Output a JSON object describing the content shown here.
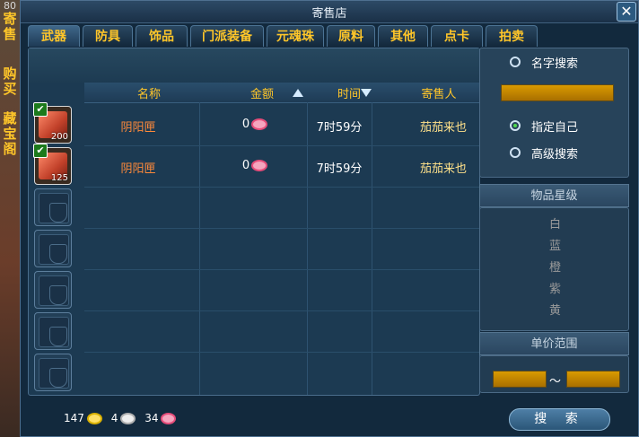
{
  "side": {
    "level": "80",
    "tabs": [
      {
        "label": [
          "寄",
          "售"
        ]
      },
      {
        "label": [
          "购",
          "买"
        ]
      },
      {
        "label": [
          "藏",
          "宝",
          "阁"
        ]
      }
    ]
  },
  "window": {
    "title": "寄售店",
    "close": "✕"
  },
  "tabs": [
    "武器",
    "防具",
    "饰品",
    "门派装备",
    "元魂珠",
    "原料",
    "其他",
    "点卡",
    "拍卖"
  ],
  "active_tab": 0,
  "table": {
    "headers": {
      "name": "名称",
      "price": "金额",
      "time": "时间",
      "seller": "寄售人"
    },
    "rows": [
      {
        "qty": "200",
        "name": "阴阳匣",
        "price": "0",
        "time": "7时59分",
        "seller": "茄茄来也"
      },
      {
        "qty": "125",
        "name": "阴阳匣",
        "price": "0",
        "time": "7时59分",
        "seller": "茄茄来也"
      }
    ]
  },
  "search": {
    "name_search": "名字搜索",
    "self": "指定自己",
    "advanced": "高级搜索",
    "grade_title": "物品星级",
    "grades": [
      "白",
      "蓝",
      "橙",
      "紫",
      "黄"
    ],
    "price_title": "单价范围",
    "range_sep": "～",
    "button": "搜 索"
  },
  "currency": {
    "gold": "147",
    "silver": "4",
    "pink": "34"
  },
  "colors": {
    "accent": "#ffc629",
    "item_name": "#ff8a3a",
    "field": "#d99a00"
  }
}
